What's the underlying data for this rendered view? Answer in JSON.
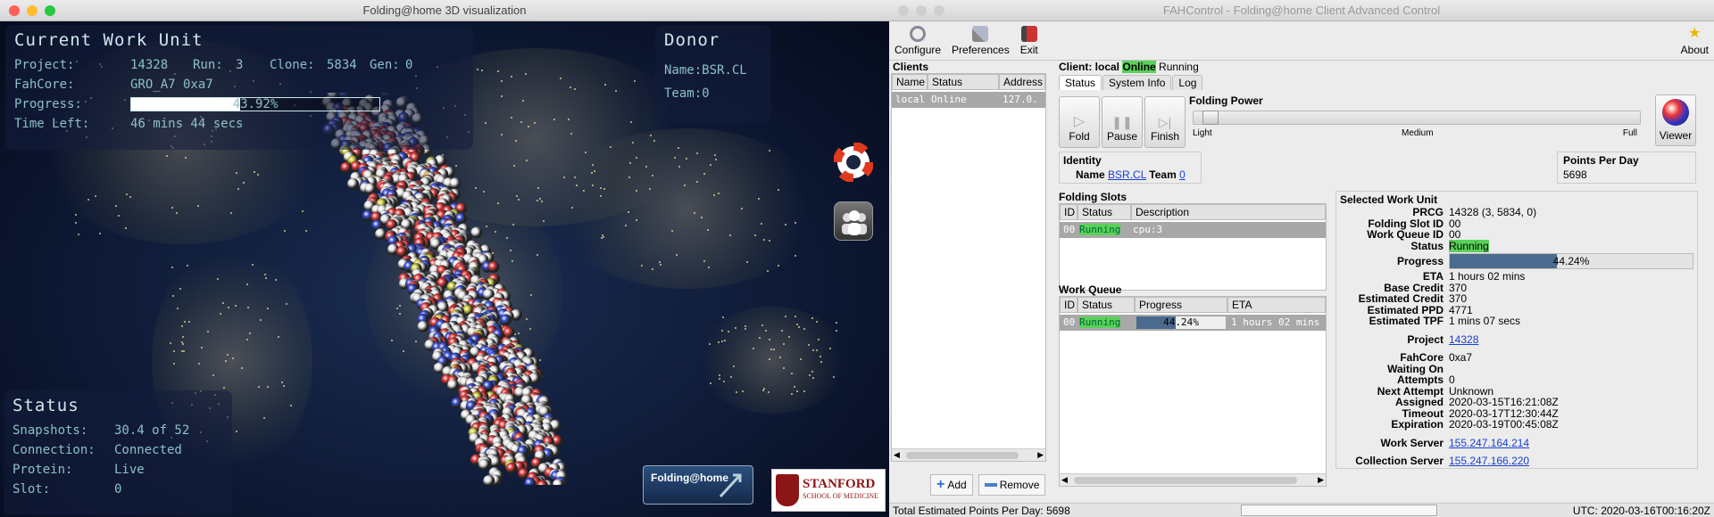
{
  "viz": {
    "title": "Folding@home 3D visualization",
    "work_unit": {
      "heading": "Current Work Unit",
      "project_label": "Project:",
      "project": "14328",
      "run_label": "Run:",
      "run": "3",
      "clone_label": "Clone:",
      "clone": "5834",
      "gen_label": "Gen:",
      "gen": "0",
      "fahcore_label": "FahCore:",
      "fahcore": "GRO_A7 0xa7",
      "progress_label": "Progress:",
      "progress_text": "43.92%",
      "progress_value": 0.4392,
      "time_left_label": "Time Left:",
      "time_left": "46 mins 44 secs"
    },
    "donor": {
      "heading": "Donor",
      "name_label": "Name:",
      "name": "BSR.CL",
      "team_label": "Team:",
      "team": "0"
    },
    "status": {
      "heading": "Status",
      "snapshots_label": "Snapshots:",
      "snapshots": "30.4 of 52",
      "connection_label": "Connection:",
      "connection": "Connected",
      "protein_label": "Protein:",
      "protein": "Live",
      "slot_label": "Slot:",
      "slot": "0"
    },
    "logos": {
      "fah": "Folding@home",
      "stanford": "STANFORD",
      "stanford_sub": "SCHOOL OF MEDICINE"
    }
  },
  "fah": {
    "title": "FAHControl - Folding@home Client Advanced Control",
    "toolbar": {
      "configure": "Configure",
      "preferences": "Preferences",
      "exit": "Exit",
      "about": "About"
    },
    "clients": {
      "heading": "Clients",
      "columns": [
        "Name",
        "Status",
        "Address"
      ],
      "rows": [
        {
          "name": "local",
          "status": "Online",
          "address": "127.0."
        }
      ],
      "add": "Add",
      "remove": "Remove"
    },
    "client_header": {
      "prefix": "Client: local",
      "online": "Online",
      "state": "Running"
    },
    "tabs": [
      "Status",
      "System Info",
      "Log"
    ],
    "buttons": {
      "fold": "Fold",
      "pause": "Pause",
      "finish": "Finish",
      "viewer": "Viewer"
    },
    "folding_power": {
      "heading": "Folding Power",
      "light": "Light",
      "medium": "Medium",
      "full": "Full",
      "level": 0.02
    },
    "identity": {
      "heading": "Identity",
      "name_label": "Name",
      "name": "BSR.CL",
      "team_label": "Team",
      "team": "0"
    },
    "ppd": {
      "heading": "Points Per Day",
      "value": "5698"
    },
    "slots": {
      "heading": "Folding Slots",
      "columns": [
        "ID",
        "Status",
        "Description"
      ],
      "rows": [
        {
          "id": "00",
          "status": "Running",
          "desc": "cpu:3"
        }
      ]
    },
    "queue": {
      "heading": "Work Queue",
      "columns": [
        "ID",
        "Status",
        "Progress",
        "ETA"
      ],
      "rows": [
        {
          "id": "00",
          "status": "Running",
          "progress": "44.24%",
          "progress_value": 0.4424,
          "eta": "1 hours 02 mins"
        }
      ]
    },
    "swu": {
      "heading": "Selected Work Unit",
      "prcg_label": "PRCG",
      "prcg": "14328 (3, 5834, 0)",
      "slot_label": "Folding Slot ID",
      "slot": "00",
      "wq_label": "Work Queue ID",
      "wq": "00",
      "status_label": "Status",
      "status": "Running",
      "progress_label": "Progress",
      "progress": "44.24%",
      "progress_value": 0.4424,
      "eta_label": "ETA",
      "eta": "1 hours 02 mins",
      "base_credit_label": "Base Credit",
      "base_credit": "370",
      "est_credit_label": "Estimated Credit",
      "est_credit": "370",
      "ppd_label": "Estimated PPD",
      "ppd": "4771",
      "tpf_label": "Estimated TPF",
      "tpf": "1 mins 07 secs",
      "project_label": "Project",
      "project": "14328",
      "fahcore_label": "FahCore",
      "fahcore": "0xa7",
      "waiting_label": "Waiting On",
      "waiting": "",
      "attempts_label": "Attempts",
      "attempts": "0",
      "next_label": "Next Attempt",
      "next": "Unknown",
      "assigned_label": "Assigned",
      "assigned": "2020-03-15T16:21:08Z",
      "timeout_label": "Timeout",
      "timeout": "2020-03-17T12:30:44Z",
      "expiration_label": "Expiration",
      "expiration": "2020-03-19T00:45:08Z",
      "ws_label": "Work Server",
      "ws": "155.247.164.214",
      "cs_label": "Collection Server",
      "cs": "155.247.166.220"
    },
    "statusbar": {
      "total": "Total Estimated Points Per Day: 5698",
      "utc": "UTC: 2020-03-16T00:16:20Z"
    }
  },
  "colors": {
    "accent_green": "#5ad15a",
    "progress_blue": "#4a6a8e",
    "mono_text": "#8ec0c6"
  }
}
